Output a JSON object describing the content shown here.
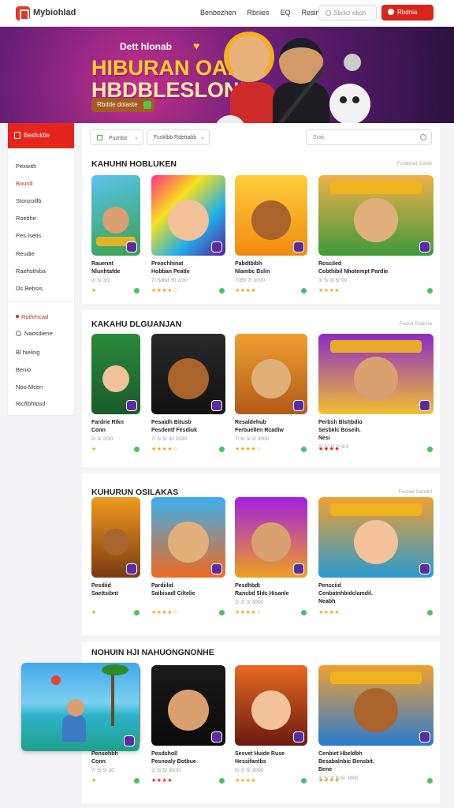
{
  "header": {
    "brand": "Mybiohlad",
    "nav": [
      "Benbezhen",
      "Rbnies",
      "EQ",
      "Resing"
    ],
    "search_placeholder": "Sbckz ekon",
    "cta": "Rbdnia"
  },
  "banner": {
    "eyebrow": "Dett hlonab",
    "headline_1": "HIBURAN OAN",
    "headline_2": "HBDBLESLON!",
    "cta": "Rbdde dolaste"
  },
  "sidebar": {
    "header": "Besfuktie",
    "items": [
      "Pexwith",
      "Bourdi",
      "Stonzoillb",
      "Roetihe",
      "Pes Iselis",
      "Reudie",
      "Raehsthiba",
      "Ds Bebsis"
    ],
    "items2": [
      "Roihrhcad",
      "Naosdiene",
      "Bl hieling",
      "Benio",
      "Noo Mcen",
      "Ricftbhtosd"
    ]
  },
  "toolbar": {
    "filter_1": "Puznbz",
    "filter_2": "Fcsklbb Rdetiabb",
    "search_placeholder": "Srak"
  },
  "sections": [
    {
      "title": "KAHUHN HOBLUKEN",
      "more": "Fosbtnet Cehie",
      "cards": [
        {
          "name_1": "Rauennt",
          "name_2": "Nlunhtafde",
          "meta": "2/ 3/ 3/3",
          "stars": "★",
          "stars_red": false
        },
        {
          "name_1": "Preochhinat",
          "name_2": "Hobban Peatle",
          "meta": "7/ Sdbd 30 2/30",
          "stars": "★★★★☆",
          "stars_red": false
        },
        {
          "name_1": "Pabdtbibh",
          "name_2": "Nlambc Bslin",
          "meta": "7/35/ 7/ 3000",
          "stars": "★★★★",
          "stars_red": false
        },
        {
          "name_1": "Rosciled",
          "name_2": "Cobthibil Nhotempt Pardie",
          "meta": "3/ 5/ 3/ 5/ 00",
          "stars": "★★★★",
          "stars_red": false
        }
      ]
    },
    {
      "title": "KAKAHU DLGUANJAN",
      "more": "Fosnd Robicla",
      "cards": [
        {
          "name_1": "Fardrie Rikn",
          "name_2": "Conn",
          "meta": "2/ 3/ 2/30",
          "stars": "★",
          "stars_red": false
        },
        {
          "name_1": "Pesaidh Bitusb",
          "name_2": "Pesdentf Fesdiuk",
          "meta": "7/ 5/ 5/ 30 2030",
          "stars": "★★★★☆",
          "stars_red": false
        },
        {
          "name_1": "Resaldehub",
          "name_2": "Ferbuellen Rcadiw",
          "meta": "7/ 6/ 5/ 2/ 3000",
          "stars": "★★★★☆",
          "stars_red": false
        },
        {
          "name_1": "Perbsh Blshbdio",
          "name_2": "Sesbklc Boseih.",
          "meta": "2/ 5/ 3/ 2/ 3/3",
          "stars": "★★★★",
          "stars_red": true,
          "name_3": "Nesi"
        }
      ]
    },
    {
      "title": "KUHURUN OSILAKAS",
      "more": "Fosnet Cendid",
      "cards": [
        {
          "name_1": "Pesdiid",
          "name_2": "Saettsibnt",
          "meta": "",
          "stars": "★",
          "stars_red": false
        },
        {
          "name_1": "Pardiilid",
          "name_2": "Saibisadl Ciltelie",
          "meta": "",
          "stars": "★★★★☆",
          "stars_red": false
        },
        {
          "name_1": "Pesdhbdt",
          "name_2": "Rancbd 5ldc Hisanle",
          "meta": "2/ 3/ 3/ 3000",
          "stars": "★★★★☆",
          "stars_red": false
        },
        {
          "name_1": "Pensciid",
          "name_2": "Cenbatnhbidclamdil.",
          "meta": "",
          "stars": "★★★★",
          "stars_red": false,
          "name_3": "Neabh"
        }
      ]
    },
    {
      "title": "NOHUIN HJI NAHUONGNONHE",
      "more": "",
      "cards": [
        {
          "name_1": "Pensohbh",
          "name_2": "Conn",
          "meta": "7/ 5/ 5/ 30",
          "stars": "★",
          "stars_red": false
        },
        {
          "name_1": "Pesdsholl",
          "name_2": "Pesnoaly Botbue",
          "meta": "2/ 5/ 5/ 30/30",
          "stars": "★★★★",
          "stars_red": true
        },
        {
          "name_1": "Sesvet Huide Ruse",
          "name_2": "Hessifantbs",
          "meta": "5/ 3/ 5/ 3000",
          "stars": "★★★★",
          "stars_red": false
        },
        {
          "name_1": "Cenbiet Hbeldbh",
          "name_2": "Besabalnbic Bensbit.",
          "meta": "3/ 5/ 3/ 5/ 5/ 3000",
          "stars": "★★★★",
          "stars_red": false,
          "name_3": "Bene"
        }
      ]
    }
  ],
  "colors": {
    "accent": "#d9241d",
    "banner_title": "#ffcf2b",
    "star": "#f0a418"
  }
}
